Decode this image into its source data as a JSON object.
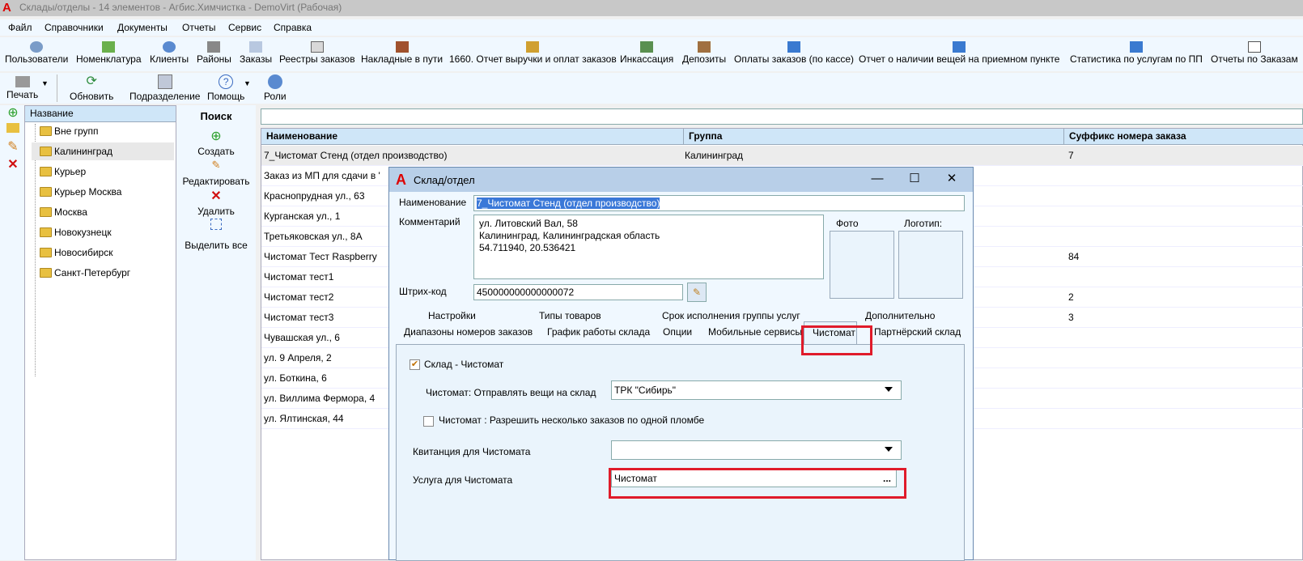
{
  "window": {
    "title": "Склады/отделы - 14 элементов - Агбис.Химчистка - DemoVirt (Рабочая)"
  },
  "menu": [
    "Файл",
    "Справочники",
    "Документы",
    "Отчеты",
    "Сервис",
    "Справка"
  ],
  "toolbar1": [
    "Пользователи",
    "Номенклатура",
    "Клиенты",
    "Районы",
    "Заказы",
    "Реестры заказов",
    "Накладные в пути",
    "1660. Отчет выручки и оплат заказов",
    "Инкассация",
    "Депозиты",
    "Оплаты заказов (по кассе)",
    "Отчет о наличии вещей на приемном пункте",
    "Статистика по услугам по ПП",
    "Отчеты по Заказам"
  ],
  "toolbar2": [
    "Печать",
    "Обновить",
    "Подразделение",
    "Помощь",
    "Роли"
  ],
  "tree": {
    "header": "Название",
    "nodes": [
      "Вне групп",
      "Калининград",
      "Курьер",
      "Курьер Москва",
      "Москва",
      "Новокузнецк",
      "Новосибирск",
      "Санкт-Петербург"
    ]
  },
  "actions": {
    "title": "Поиск",
    "create": "Создать",
    "edit": "Редактировать",
    "delete": "Удалить",
    "select_all": "Выделить все"
  },
  "grid": {
    "headers": [
      "Наименование",
      "Группа",
      "Суффикс номера заказа"
    ],
    "rows": [
      [
        "7_Чистомат Стенд (отдел производство)",
        "Калининград",
        "7"
      ],
      [
        "Заказ из МП для сдачи в '",
        "",
        ""
      ],
      [
        "Краснопрудная ул., 63",
        "",
        ""
      ],
      [
        "Курганская ул., 1",
        "",
        ""
      ],
      [
        "Третьяковская ул., 8А",
        "",
        ""
      ],
      [
        "Чистомат Тест Raspberry",
        "",
        "84"
      ],
      [
        "Чистомат тест1",
        "",
        ""
      ],
      [
        "Чистомат тест2",
        "",
        "2"
      ],
      [
        "Чистомат тест3",
        "",
        "3"
      ],
      [
        "Чувашская ул., 6",
        "",
        ""
      ],
      [
        "ул. 9 Апреля, 2",
        "",
        ""
      ],
      [
        "ул. Боткина, 6",
        "",
        ""
      ],
      [
        "ул. Виллима Фермора, 4",
        "",
        ""
      ],
      [
        "ул. Ялтинская, 44",
        "",
        ""
      ]
    ]
  },
  "dialog": {
    "title": "Склад/отдел",
    "name_label": "Наименование",
    "name_value": "7_Чистомат Стенд (отдел производство)",
    "comment_label": "Комментарий",
    "comment_lines": [
      "ул. Литовский Вал, 58",
      "Калининград, Калининградская область",
      "54.711940, 20.536421"
    ],
    "photo_label": "Фото",
    "logo_label": "Логотип:",
    "barcode_label": "Штрих-код",
    "barcode_value": "450000000000000072",
    "tabs_row1": [
      "Настройки",
      "Типы товаров",
      "Срок исполнения группы услуг",
      "Дополнительно"
    ],
    "tabs_row2": [
      "Диапазоны номеров заказов",
      "График работы склада",
      "Опции",
      "Мобильные сервисы",
      "Чистомат",
      "Партнёрский склад"
    ],
    "panel": {
      "warehouse_check": "Склад - Чистомат",
      "send_label": "Чистомат: Отправлять вещи на склад",
      "send_value": "ТРК \"Сибирь\"",
      "multi_check": "Чистомат : Разрешить несколько заказов по одной пломбе",
      "receipt_label": "Квитанция для Чистомата",
      "receipt_value": "",
      "service_label": "Услуга для Чистомата",
      "service_value": "Чистомат",
      "ellipsis": "..."
    }
  }
}
